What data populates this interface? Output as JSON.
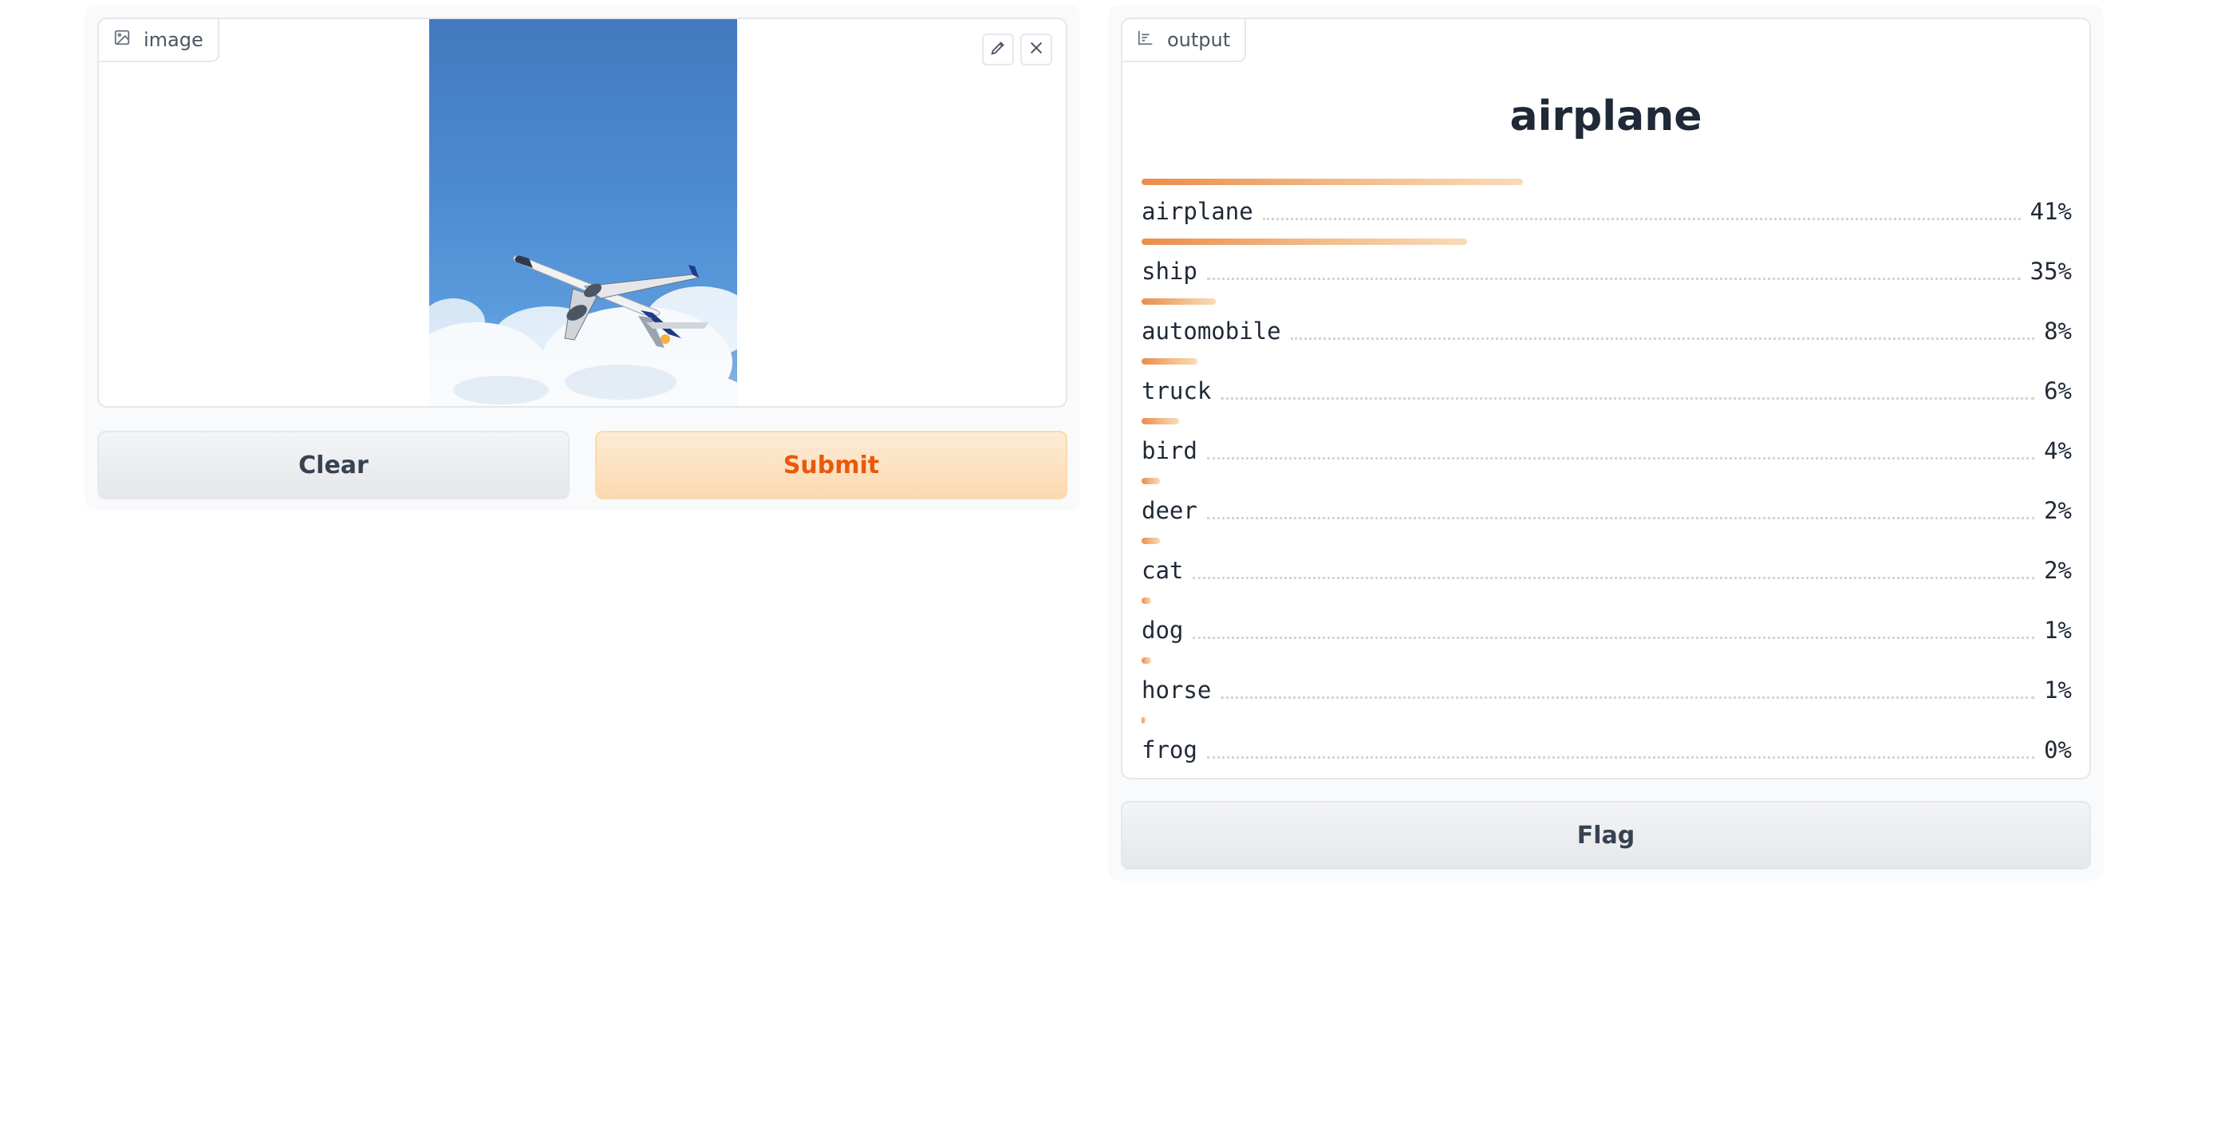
{
  "input": {
    "tab_label": "image",
    "image_description_icon": "image-icon",
    "edit_icon": "pencil-icon",
    "close_icon": "close-icon"
  },
  "buttons": {
    "clear": "Clear",
    "submit": "Submit",
    "flag": "Flag"
  },
  "output": {
    "tab_label": "output",
    "tab_icon": "bar-chart-icon",
    "predicted_label": "airplane",
    "confidences": [
      {
        "label": "airplane",
        "percent": "41%",
        "value": 0.41
      },
      {
        "label": "ship",
        "percent": "35%",
        "value": 0.35
      },
      {
        "label": "automobile",
        "percent": "8%",
        "value": 0.08
      },
      {
        "label": "truck",
        "percent": "6%",
        "value": 0.06
      },
      {
        "label": "bird",
        "percent": "4%",
        "value": 0.04
      },
      {
        "label": "deer",
        "percent": "2%",
        "value": 0.02
      },
      {
        "label": "cat",
        "percent": "2%",
        "value": 0.02
      },
      {
        "label": "dog",
        "percent": "1%",
        "value": 0.01
      },
      {
        "label": "horse",
        "percent": "1%",
        "value": 0.01
      },
      {
        "label": "frog",
        "percent": "0%",
        "value": 0.004
      }
    ]
  },
  "colors": {
    "accent_orange": "#ea580c",
    "bar_start": "#eb8c4a",
    "bar_end": "#f8dbb8",
    "submit_bg": "#fbd9b0"
  }
}
